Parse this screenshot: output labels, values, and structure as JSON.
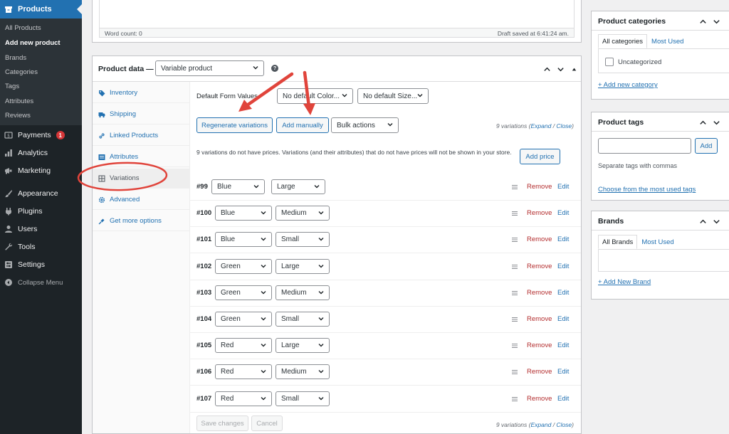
{
  "colors": {
    "accent": "#2271b1",
    "remove": "#b32d2e",
    "annotation": "#e0443b",
    "sidebar_bg": "#1d2327"
  },
  "adminmenu": {
    "current": {
      "label": "Products",
      "icon": "archive-icon"
    },
    "submenu": [
      "All Products",
      "Add new product",
      "Brands",
      "Categories",
      "Tags",
      "Attributes",
      "Reviews"
    ],
    "items": [
      {
        "label": "Payments",
        "icon": "payments-icon",
        "badge": "1"
      },
      {
        "label": "Analytics",
        "icon": "analytics-icon"
      },
      {
        "label": "Marketing",
        "icon": "megaphone-icon"
      },
      {
        "label": "Appearance",
        "icon": "brush-icon"
      },
      {
        "label": "Plugins",
        "icon": "plugin-icon"
      },
      {
        "label": "Users",
        "icon": "user-icon"
      },
      {
        "label": "Tools",
        "icon": "wrench-icon"
      },
      {
        "label": "Settings",
        "icon": "settings-icon"
      }
    ],
    "collapse_label": "Collapse Menu"
  },
  "editor": {
    "word_count": "Word count: 0",
    "draft_status": "Draft saved at 6:41:24 am."
  },
  "product_data": {
    "title": "Product data —",
    "type_value": "Variable product",
    "tabs": [
      "Inventory",
      "Shipping",
      "Linked Products",
      "Attributes",
      "Variations",
      "Advanced",
      "Get more options"
    ],
    "default_form_label": "Default Form Values",
    "default_color": "No default Color...",
    "default_size": "No default Size...",
    "regenerate_label": "Regenerate variations",
    "add_manually_label": "Add manually",
    "bulk_actions_label": "Bulk actions",
    "variations_count": "9 variations",
    "expand_label": "Expand",
    "close_label": "Close",
    "notice": "9 variations do not have prices. Variations (and their attributes) that do not have prices will not be shown in your store.",
    "add_price_label": "Add price",
    "remove_label": "Remove",
    "edit_label": "Edit",
    "variations": [
      {
        "id": "#99",
        "color": "Blue",
        "size": "Large"
      },
      {
        "id": "#100",
        "color": "Blue",
        "size": "Medium"
      },
      {
        "id": "#101",
        "color": "Blue",
        "size": "Small"
      },
      {
        "id": "#102",
        "color": "Green",
        "size": "Large"
      },
      {
        "id": "#103",
        "color": "Green",
        "size": "Medium"
      },
      {
        "id": "#104",
        "color": "Green",
        "size": "Small"
      },
      {
        "id": "#105",
        "color": "Red",
        "size": "Large"
      },
      {
        "id": "#106",
        "color": "Red",
        "size": "Medium"
      },
      {
        "id": "#107",
        "color": "Red",
        "size": "Small"
      }
    ],
    "save_label": "Save changes",
    "cancel_label": "Cancel"
  },
  "categories": {
    "title": "Product categories",
    "tab_all": "All categories",
    "tab_used": "Most Used",
    "item": "Uncategorized",
    "add_link": "+ Add new category"
  },
  "tags": {
    "title": "Product tags",
    "add_label": "Add",
    "help": "Separate tags with commas",
    "choose_link": "Choose from the most used tags"
  },
  "brands": {
    "title": "Brands",
    "tab_all": "All Brands",
    "tab_used": "Most Used",
    "add_link": "+ Add New Brand"
  }
}
